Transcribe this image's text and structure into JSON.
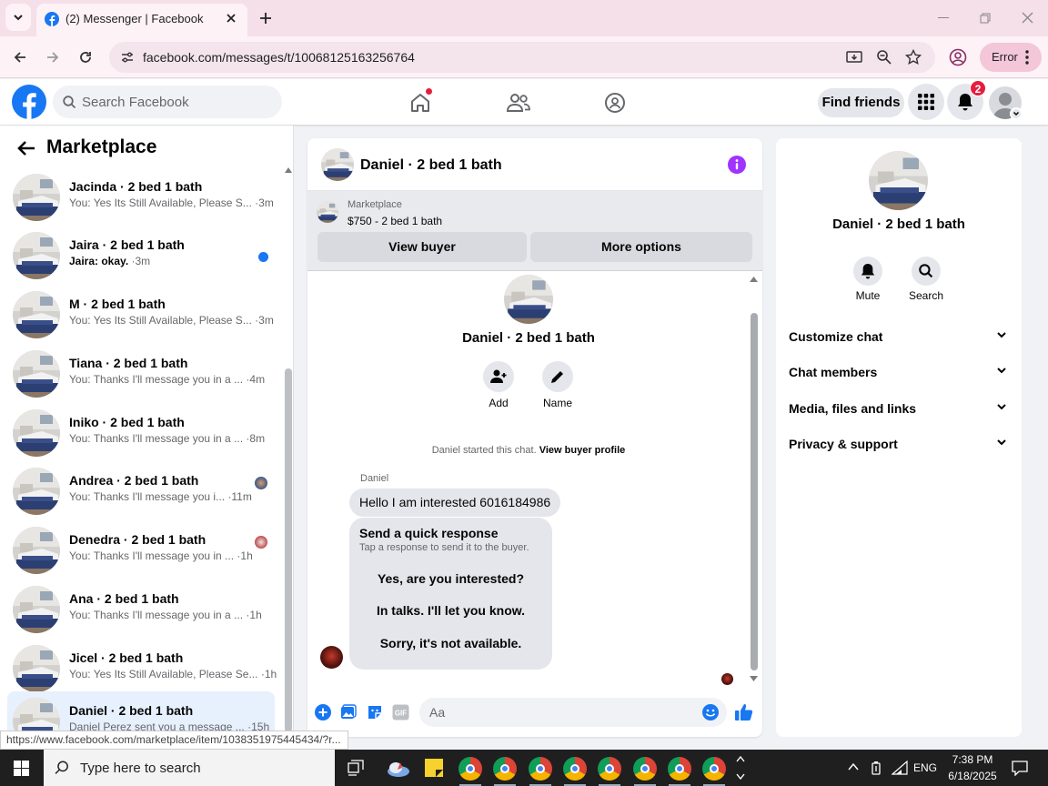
{
  "browser": {
    "tab_title": "(2) Messenger | Facebook",
    "url": "facebook.com/messages/t/10068125163256764",
    "profile_label": "Error"
  },
  "fb": {
    "search_placeholder": "Search Facebook",
    "find_friends": "Find friends",
    "notif_count": "2",
    "accent": "#1877f2"
  },
  "sidebar": {
    "title": "Marketplace",
    "conversations": [
      {
        "name": "Jacinda · 2 bed 1 bath",
        "preview": "You: Yes Its Still Available, Please S...",
        "time": "·3m",
        "unread": false
      },
      {
        "name": "Jaira · 2 bed 1 bath",
        "preview": "Jaira: okay.",
        "time": "·3m",
        "unread": true
      },
      {
        "name": "M · 2 bed 1 bath",
        "preview": "You: Yes Its Still Available, Please S...",
        "time": "·3m",
        "unread": false
      },
      {
        "name": "Tiana · 2 bed 1 bath",
        "preview": "You: Thanks I'll message you in a ...",
        "time": "·4m",
        "unread": false
      },
      {
        "name": "Iniko · 2 bed 1 bath",
        "preview": "You: Thanks I'll message you in a ...",
        "time": "·8m",
        "unread": false
      },
      {
        "name": "Andrea · 2 bed 1 bath",
        "preview": "You: Thanks I'll message you i...",
        "time": "·11m",
        "unread": false
      },
      {
        "name": "Denedra · 2 bed 1 bath",
        "preview": "You: Thanks I'll message you in ...",
        "time": "·1h",
        "unread": false
      },
      {
        "name": "Ana · 2 bed 1 bath",
        "preview": "You: Thanks I'll message you in a ...",
        "time": "·1h",
        "unread": false
      },
      {
        "name": "Jicel · 2 bed 1 bath",
        "preview": "You: Yes Its Still Available, Please Se...",
        "time": "·1h",
        "unread": false
      },
      {
        "name": "Daniel · 2 bed 1 bath",
        "preview": "Daniel Perez sent you a message ...",
        "time": "·15h",
        "unread": false
      }
    ]
  },
  "chat": {
    "header_title": "Daniel · 2 bed 1 bath",
    "listing_source": "Marketplace",
    "listing_price": "$750 - 2 bed 1 bath",
    "view_buyer": "View buyer",
    "more_options": "More options",
    "profile_name": "Daniel · 2 bed 1 bath",
    "add_label": "Add",
    "name_label": "Name",
    "started_text": "Daniel started this chat.",
    "view_profile_link": "View buyer profile",
    "sender": "Daniel",
    "message": "Hello I am interested 6016184986",
    "quick_title": "Send a quick response",
    "quick_sub": "Tap a response to send it to the buyer.",
    "quick_replies": [
      "Yes, are you interested?",
      "In talks. I'll let you know.",
      "Sorry, it's not available."
    ],
    "composer_placeholder": "Aa"
  },
  "info": {
    "name": "Daniel · 2 bed 1 bath",
    "mute": "Mute",
    "search": "Search",
    "sections": [
      "Customize chat",
      "Chat members",
      "Media, files and links",
      "Privacy & support"
    ]
  },
  "status_url": "https://www.facebook.com/marketplace/item/1038351975445434/?r...",
  "taskbar": {
    "search_placeholder": "Type here to search",
    "lang": "ENG",
    "time": "7:38 PM",
    "date": "6/18/2025"
  }
}
